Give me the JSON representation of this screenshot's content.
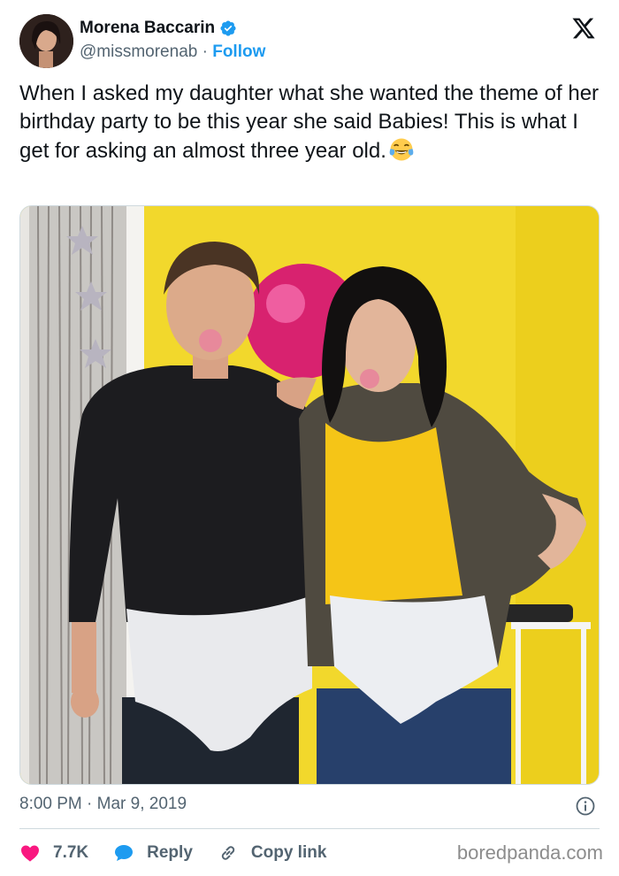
{
  "author": {
    "display_name": "Morena Baccarin",
    "handle": "@missmorenab",
    "separator": " · ",
    "follow_label": "Follow"
  },
  "tweet": {
    "text": "When I asked my daughter what she wanted the theme of her birthday party to be this year she said Babies! This is what I get for asking an almost three year old.",
    "emoji": "face-with-tears-of-joy",
    "timestamp": "8:00 PM · Mar 9, 2019"
  },
  "actions": {
    "likes": "7.7K",
    "reply_label": "Reply",
    "copy_link_label": "Copy link"
  },
  "watermark": "boredpanda.com",
  "colors": {
    "like": "#f91880",
    "reply": "#1d9bf0",
    "follow": "#1d9bf0",
    "verified": "#1d9bf0"
  }
}
